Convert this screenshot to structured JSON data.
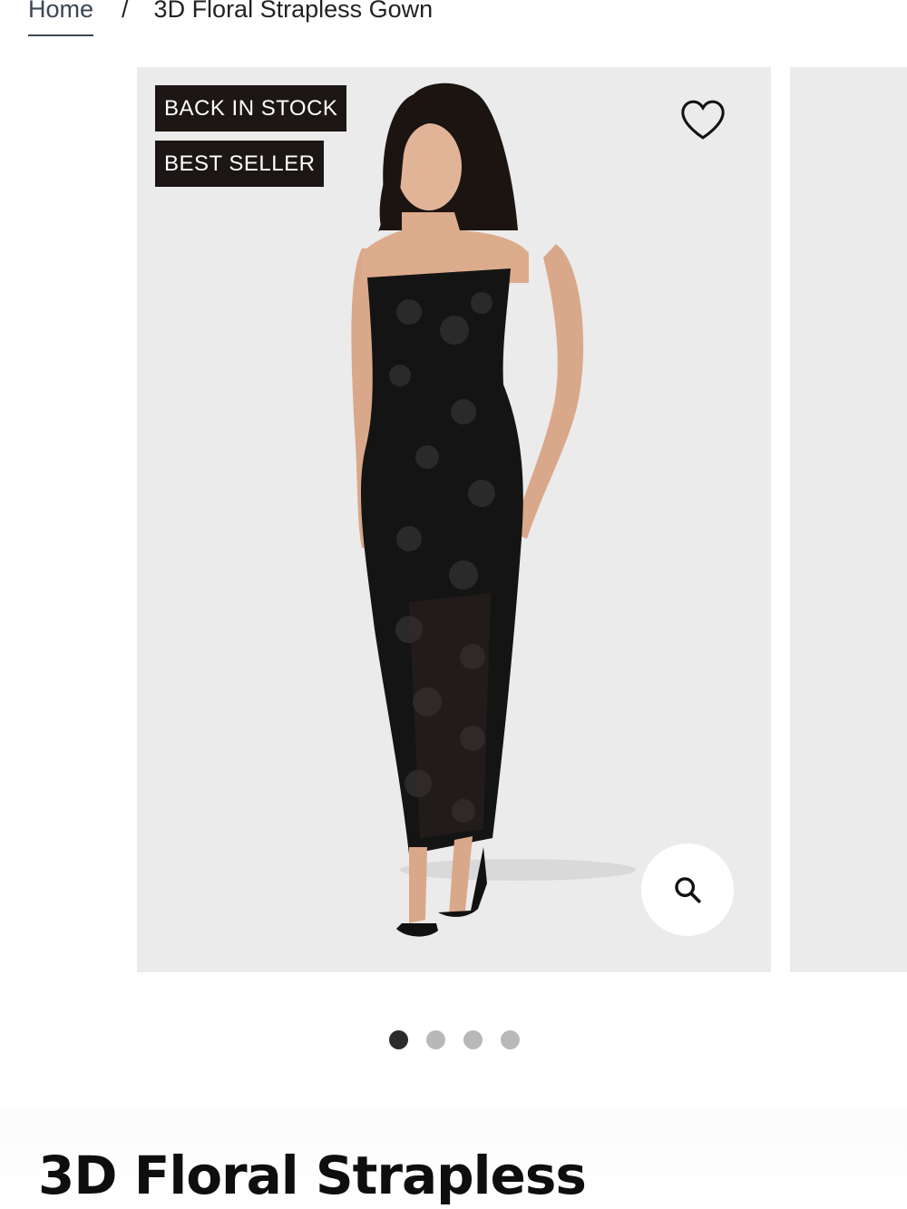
{
  "breadcrumb": {
    "home": "Home",
    "separator": "/",
    "current": "3D Floral Strapless Gown"
  },
  "gallery": {
    "badges": [
      "BACK IN STOCK",
      "BEST SELLER"
    ],
    "wishlist_icon": "heart-icon",
    "zoom_icon": "search-icon",
    "image_count": 4,
    "active_index": 0,
    "colors": {
      "background": "#ebebeb",
      "badge_bg": "#1c1714",
      "dress": "#111111"
    }
  },
  "product": {
    "title": "3D Floral Strapless"
  }
}
